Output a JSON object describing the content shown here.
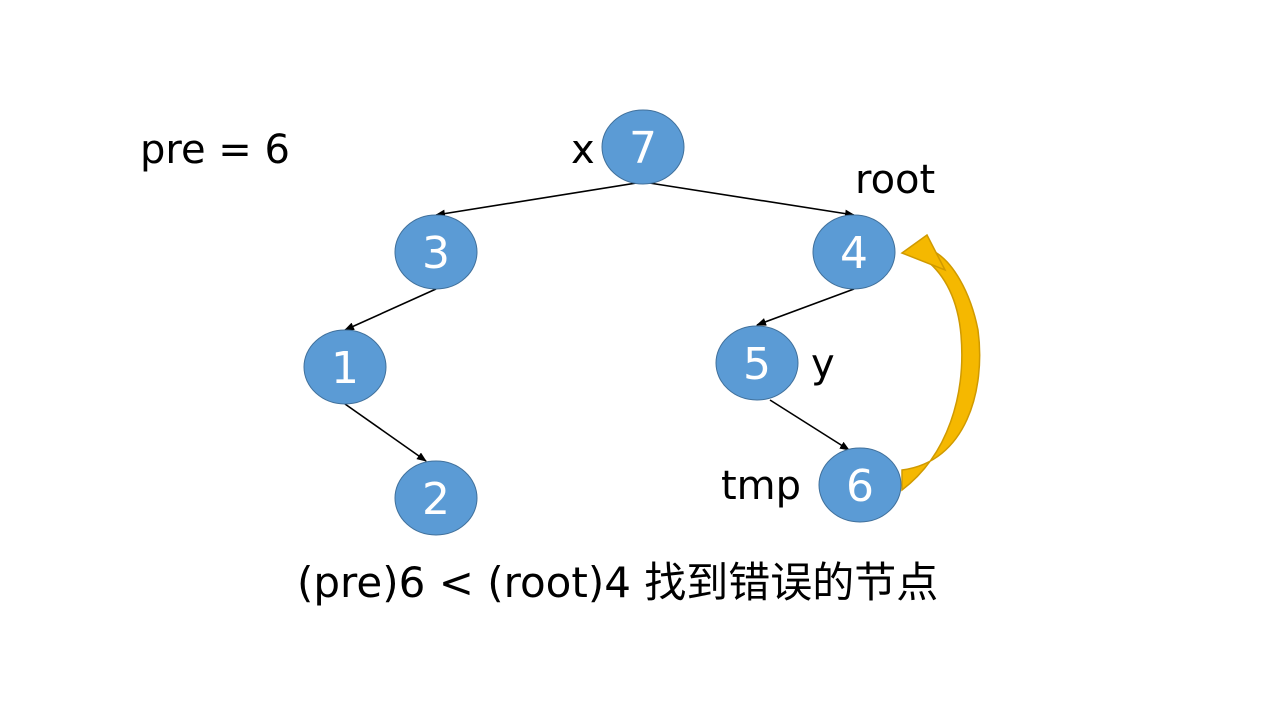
{
  "pre_label": "pre = 6",
  "node_color": "#5b9bd5",
  "node_border_color": "#41719c",
  "edge_color": "#000000",
  "arrow_color": "#f5b800",
  "arrow_shadow_color": "#d09a00",
  "nodes": [
    {
      "id": "n7",
      "value": "7"
    },
    {
      "id": "n3",
      "value": "3"
    },
    {
      "id": "n4",
      "value": "4"
    },
    {
      "id": "n1",
      "value": "1"
    },
    {
      "id": "n5",
      "value": "5"
    },
    {
      "id": "n2",
      "value": "2"
    },
    {
      "id": "n6",
      "value": "6"
    }
  ],
  "edges": [
    {
      "from": "7",
      "to": "3"
    },
    {
      "from": "7",
      "to": "4"
    },
    {
      "from": "3",
      "to": "1"
    },
    {
      "from": "1",
      "to": "2"
    },
    {
      "from": "4",
      "to": "5"
    },
    {
      "from": "5",
      "to": "6"
    }
  ],
  "pointer_labels": {
    "x": "x",
    "root": "root",
    "y": "y",
    "tmp": "tmp"
  },
  "caption": "(pre)6 < (root)4 找到错误的节点"
}
